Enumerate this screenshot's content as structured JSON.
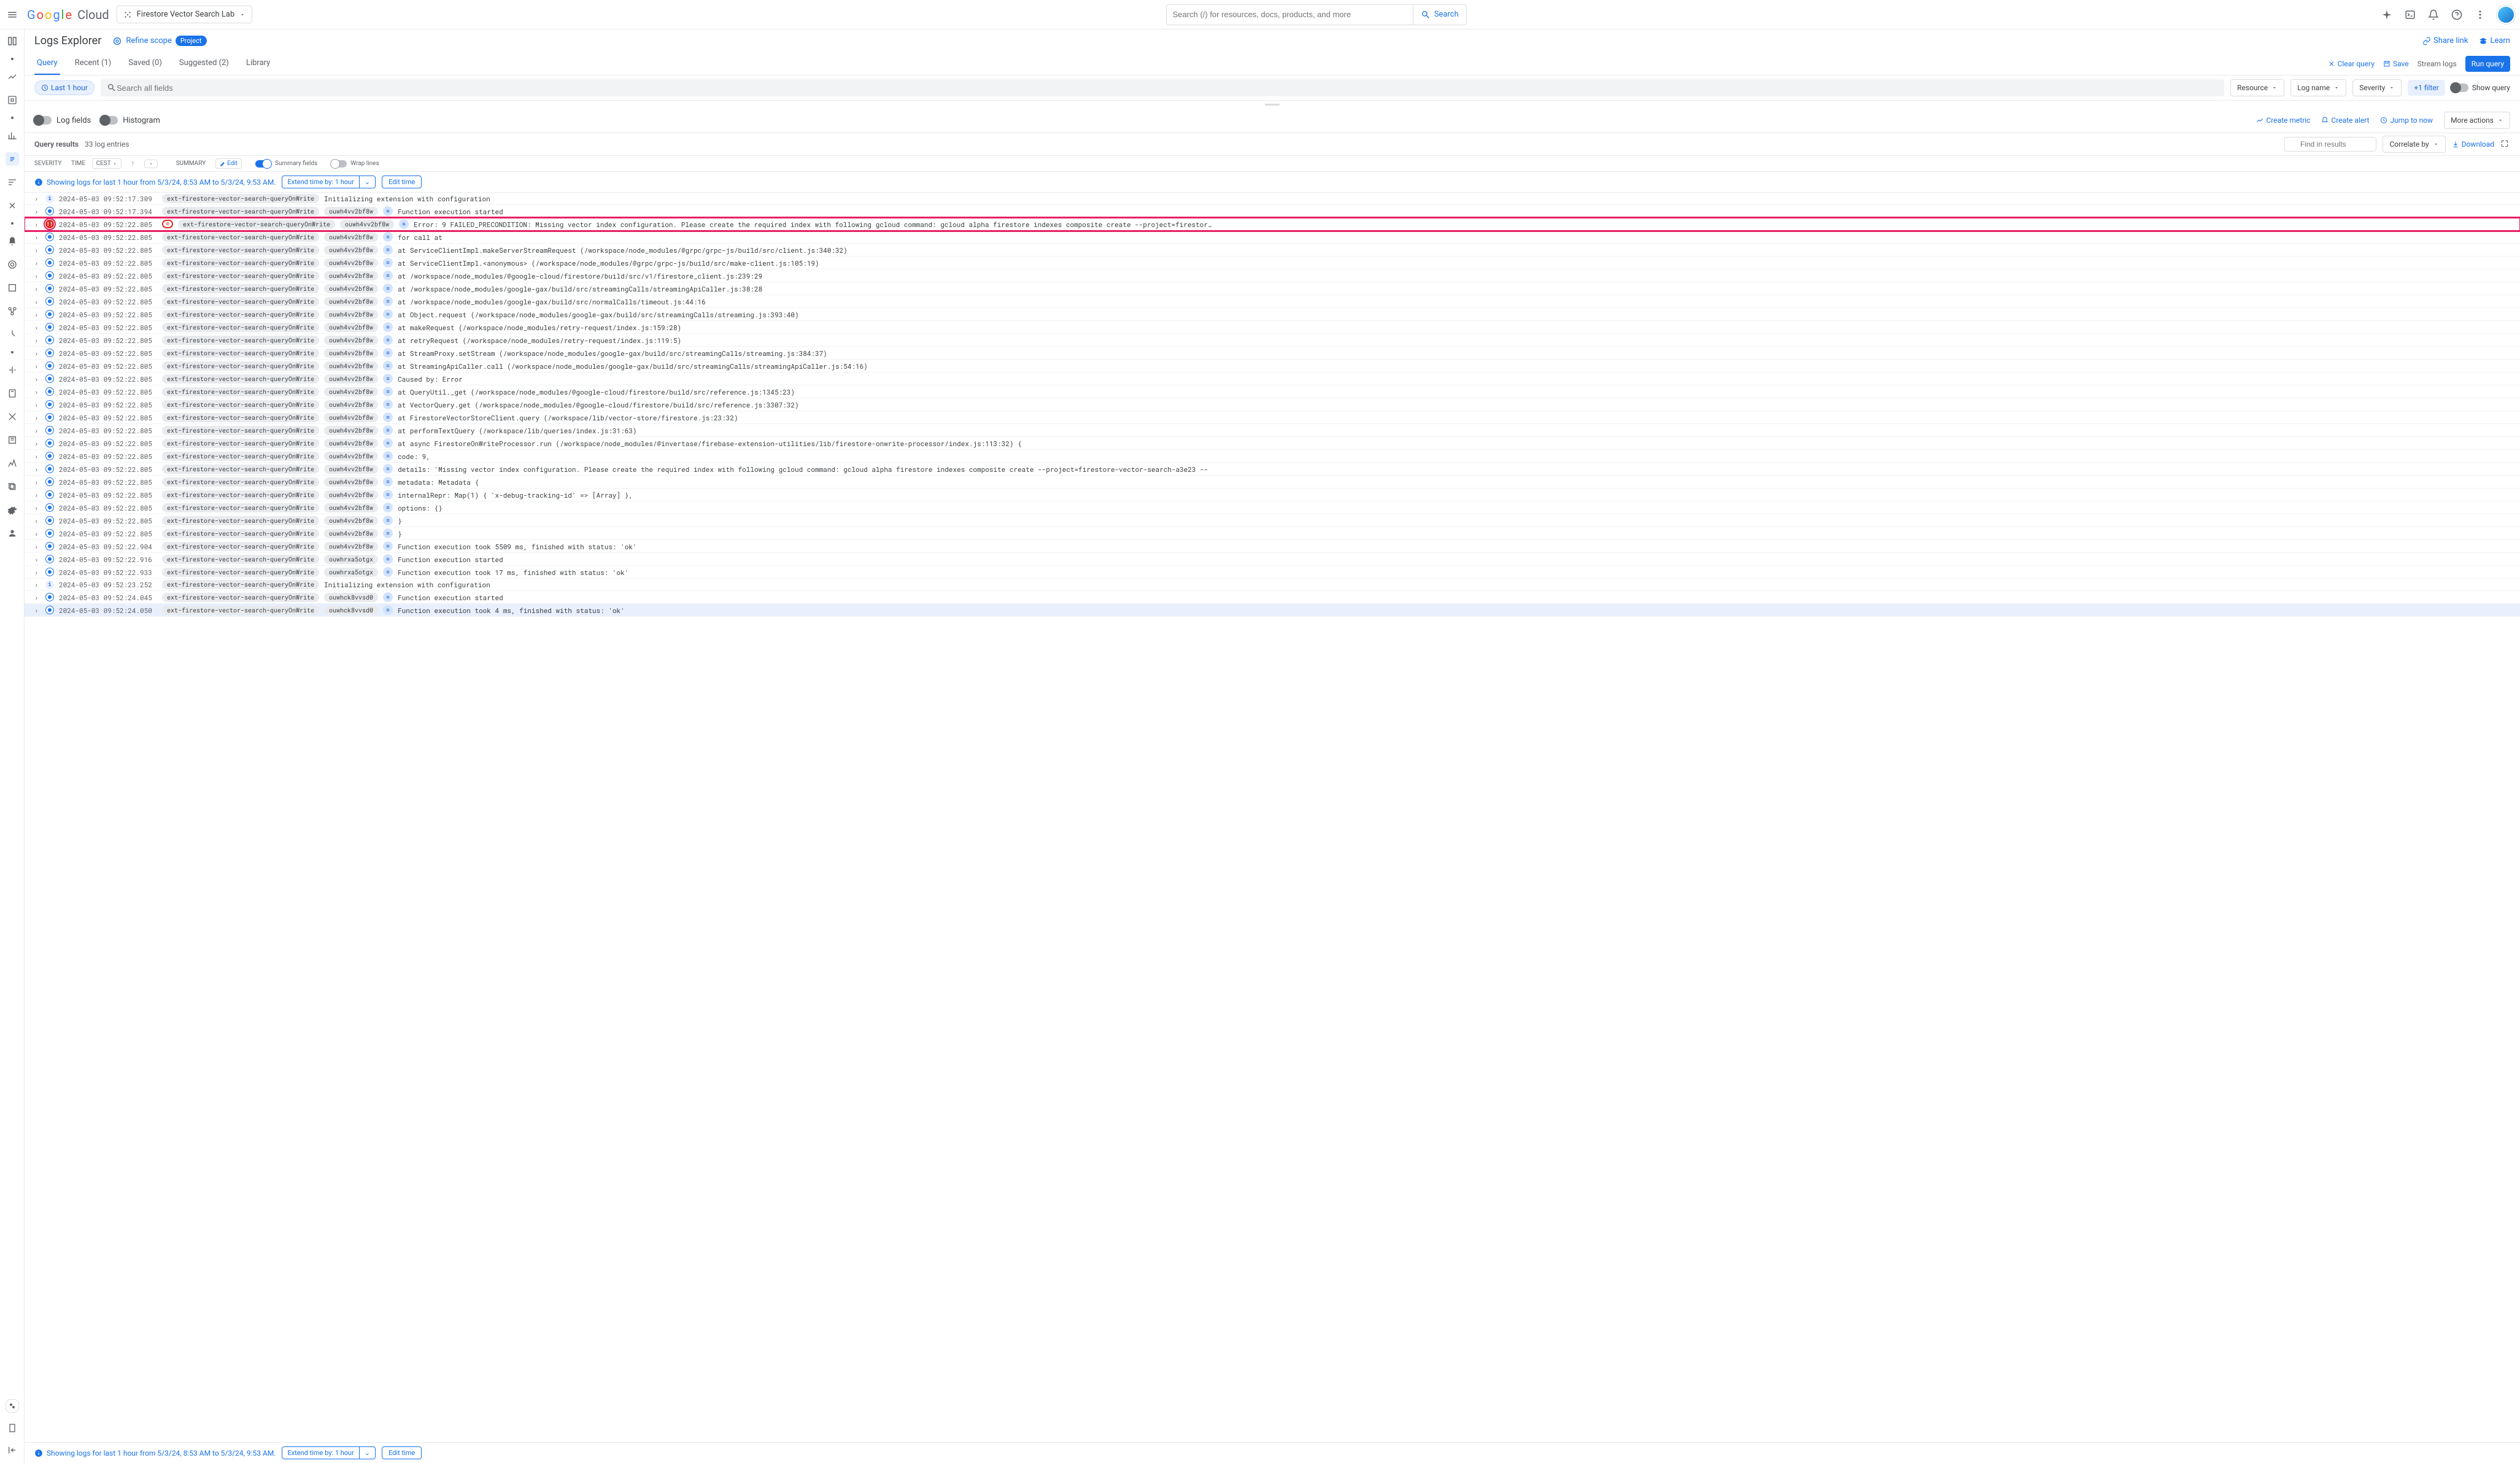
{
  "header": {
    "project": "Firestore Vector Search Lab",
    "search_placeholder": "Search (/) for resources, docs, products, and more",
    "search_btn": "Search"
  },
  "title": "Logs Explorer",
  "refine": "Refine scope",
  "project_badge": "Project",
  "share": "Share link",
  "learn": "Learn",
  "tabs": {
    "query": "Query",
    "recent": "Recent (1)",
    "saved": "Saved (0)",
    "suggested": "Suggested (2)",
    "library": "Library"
  },
  "actions": {
    "clear": "Clear query",
    "save": "Save",
    "stream": "Stream logs",
    "run": "Run query"
  },
  "filter": {
    "time_chip": "Last 1 hour",
    "search_placeholder": "Search all fields",
    "resource": "Resource",
    "logname": "Log name",
    "severity": "Severity",
    "plus1": "+1 filter",
    "showq": "Show query"
  },
  "panels": {
    "logfields": "Log fields",
    "histogram": "Histogram",
    "metric": "Create metric",
    "alert": "Create alert",
    "jump": "Jump to now",
    "more": "More actions"
  },
  "results": {
    "label": "Query results",
    "count": "33 log entries",
    "find_placeholder": "Find in results",
    "correlate": "Correlate by",
    "download": "Download"
  },
  "headers": {
    "severity": "SEVERITY",
    "time": "TIME",
    "tz": "CEST",
    "summary": "SUMMARY",
    "edit": "Edit",
    "sumfields": "Summary fields",
    "wrap": "Wrap lines"
  },
  "banner": {
    "text": "Showing logs for last 1 hour from 5/3/24, 8:53 AM to 5/3/24, 9:53 AM.",
    "extend": "Extend time by: 1 hour",
    "edit": "Edit time"
  },
  "fn": "ext-firestore-vector-search-queryOnWrite",
  "ex1": "ouwh4vv2bf8w",
  "ex2": "ouwhrxa5otgx",
  "ex3": "ouwhck8vvsd0",
  "logs": [
    {
      "sev": "info",
      "ts": "2024-05-03 09:52:17.309",
      "fn": true,
      "ex": "",
      "msg": "Initializing extension with configuration"
    },
    {
      "sev": "debug",
      "ts": "2024-05-03 09:52:17.394",
      "fn": true,
      "ex": "ouwh4vv2bf8w",
      "ic": true,
      "msg": "Function execution started"
    },
    {
      "sev": "error",
      "ts": "2024-05-03 09:52:22.805",
      "fn": true,
      "ex": "ouwh4vv2bf8w",
      "ic": true,
      "red": true,
      "hl": true,
      "msg": "Error: 9 FAILED_PRECONDITION: Missing vector index configuration. Please create the required index with following gcloud command: gcloud alpha firestore indexes composite create --project=firestor…"
    },
    {
      "sev": "debug",
      "ts": "2024-05-03 09:52:22.805",
      "fn": true,
      "ex": "ouwh4vv2bf8w",
      "ic": true,
      "msg": "for call at"
    },
    {
      "sev": "debug",
      "ts": "2024-05-03 09:52:22.805",
      "fn": true,
      "ex": "ouwh4vv2bf8w",
      "ic": true,
      "msg": "    at ServiceClientImpl.makeServerStreamRequest (/workspace/node_modules/@grpc/grpc-js/build/src/client.js:340:32)"
    },
    {
      "sev": "debug",
      "ts": "2024-05-03 09:52:22.805",
      "fn": true,
      "ex": "ouwh4vv2bf8w",
      "ic": true,
      "msg": "    at ServiceClientImpl.<anonymous> (/workspace/node_modules/@grpc/grpc-js/build/src/make-client.js:105:19)"
    },
    {
      "sev": "debug",
      "ts": "2024-05-03 09:52:22.805",
      "fn": true,
      "ex": "ouwh4vv2bf8w",
      "ic": true,
      "msg": "    at /workspace/node_modules/@google-cloud/firestore/build/src/v1/firestore_client.js:239:29"
    },
    {
      "sev": "debug",
      "ts": "2024-05-03 09:52:22.805",
      "fn": true,
      "ex": "ouwh4vv2bf8w",
      "ic": true,
      "msg": "    at /workspace/node_modules/google-gax/build/src/streamingCalls/streamingApiCaller.js:38:28"
    },
    {
      "sev": "debug",
      "ts": "2024-05-03 09:52:22.805",
      "fn": true,
      "ex": "ouwh4vv2bf8w",
      "ic": true,
      "msg": "    at /workspace/node_modules/google-gax/build/src/normalCalls/timeout.js:44:16"
    },
    {
      "sev": "debug",
      "ts": "2024-05-03 09:52:22.805",
      "fn": true,
      "ex": "ouwh4vv2bf8w",
      "ic": true,
      "msg": "    at Object.request (/workspace/node_modules/google-gax/build/src/streamingCalls/streaming.js:393:40)"
    },
    {
      "sev": "debug",
      "ts": "2024-05-03 09:52:22.805",
      "fn": true,
      "ex": "ouwh4vv2bf8w",
      "ic": true,
      "msg": "    at makeRequest (/workspace/node_modules/retry-request/index.js:159:28)"
    },
    {
      "sev": "debug",
      "ts": "2024-05-03 09:52:22.805",
      "fn": true,
      "ex": "ouwh4vv2bf8w",
      "ic": true,
      "msg": "    at retryRequest (/workspace/node_modules/retry-request/index.js:119:5)"
    },
    {
      "sev": "debug",
      "ts": "2024-05-03 09:52:22.805",
      "fn": true,
      "ex": "ouwh4vv2bf8w",
      "ic": true,
      "msg": "    at StreamProxy.setStream (/workspace/node_modules/google-gax/build/src/streamingCalls/streaming.js:384:37)"
    },
    {
      "sev": "debug",
      "ts": "2024-05-03 09:52:22.805",
      "fn": true,
      "ex": "ouwh4vv2bf8w",
      "ic": true,
      "msg": "    at StreamingApiCaller.call (/workspace/node_modules/google-gax/build/src/streamingCalls/streamingApiCaller.js:54:16)"
    },
    {
      "sev": "debug",
      "ts": "2024-05-03 09:52:22.805",
      "fn": true,
      "ex": "ouwh4vv2bf8w",
      "ic": true,
      "msg": "Caused by: Error"
    },
    {
      "sev": "debug",
      "ts": "2024-05-03 09:52:22.805",
      "fn": true,
      "ex": "ouwh4vv2bf8w",
      "ic": true,
      "msg": "    at QueryUtil._get (/workspace/node_modules/@google-cloud/firestore/build/src/reference.js:1345:23)"
    },
    {
      "sev": "debug",
      "ts": "2024-05-03 09:52:22.805",
      "fn": true,
      "ex": "ouwh4vv2bf8w",
      "ic": true,
      "msg": "    at VectorQuery.get (/workspace/node_modules/@google-cloud/firestore/build/src/reference.js:3307:32)"
    },
    {
      "sev": "debug",
      "ts": "2024-05-03 09:52:22.805",
      "fn": true,
      "ex": "ouwh4vv2bf8w",
      "ic": true,
      "msg": "    at FirestoreVectorStoreClient.query (/workspace/lib/vector-store/firestore.js:23:32)"
    },
    {
      "sev": "debug",
      "ts": "2024-05-03 09:52:22.805",
      "fn": true,
      "ex": "ouwh4vv2bf8w",
      "ic": true,
      "msg": "    at performTextQuery (/workspace/lib/queries/index.js:31:63)"
    },
    {
      "sev": "debug",
      "ts": "2024-05-03 09:52:22.805",
      "fn": true,
      "ex": "ouwh4vv2bf8w",
      "ic": true,
      "msg": "    at async FirestoreOnWriteProcessor.run (/workspace/node_modules/@invertase/firebase-extension-utilities/lib/firestore-onwrite-processor/index.js:113:32) {"
    },
    {
      "sev": "debug",
      "ts": "2024-05-03 09:52:22.805",
      "fn": true,
      "ex": "ouwh4vv2bf8w",
      "ic": true,
      "msg": "  code: 9,"
    },
    {
      "sev": "debug",
      "ts": "2024-05-03 09:52:22.805",
      "fn": true,
      "ex": "ouwh4vv2bf8w",
      "ic": true,
      "msg": "  details: 'Missing vector index configuration. Please create the required index with following gcloud command: gcloud alpha firestore indexes composite create --project=firestore-vector-search-a3e23 --"
    },
    {
      "sev": "debug",
      "ts": "2024-05-03 09:52:22.805",
      "fn": true,
      "ex": "ouwh4vv2bf8w",
      "ic": true,
      "msg": "  metadata: Metadata {"
    },
    {
      "sev": "debug",
      "ts": "2024-05-03 09:52:22.805",
      "fn": true,
      "ex": "ouwh4vv2bf8w",
      "ic": true,
      "msg": "    internalRepr: Map(1) { 'x-debug-tracking-id' => [Array] },"
    },
    {
      "sev": "debug",
      "ts": "2024-05-03 09:52:22.805",
      "fn": true,
      "ex": "ouwh4vv2bf8w",
      "ic": true,
      "msg": "    options: {}"
    },
    {
      "sev": "debug",
      "ts": "2024-05-03 09:52:22.805",
      "fn": true,
      "ex": "ouwh4vv2bf8w",
      "ic": true,
      "msg": "  }"
    },
    {
      "sev": "debug",
      "ts": "2024-05-03 09:52:22.805",
      "fn": true,
      "ex": "ouwh4vv2bf8w",
      "ic": true,
      "msg": "}"
    },
    {
      "sev": "debug",
      "ts": "2024-05-03 09:52:22.904",
      "fn": true,
      "ex": "ouwh4vv2bf8w",
      "ic": true,
      "msg": "Function execution took 5509 ms, finished with status: 'ok'"
    },
    {
      "sev": "debug",
      "ts": "2024-05-03 09:52:22.916",
      "fn": true,
      "ex": "ouwhrxa5otgx",
      "ic": true,
      "msg": "Function execution started"
    },
    {
      "sev": "debug",
      "ts": "2024-05-03 09:52:22.933",
      "fn": true,
      "ex": "ouwhrxa5otgx",
      "ic": true,
      "msg": "Function execution took 17 ms, finished with status: 'ok'"
    },
    {
      "sev": "info",
      "ts": "2024-05-03 09:52:23.252",
      "fn": true,
      "ex": "",
      "msg": "Initializing extension with configuration"
    },
    {
      "sev": "debug",
      "ts": "2024-05-03 09:52:24.045",
      "fn": true,
      "ex": "ouwhck8vvsd0",
      "ic": true,
      "msg": "Function execution started"
    },
    {
      "sev": "debug",
      "ts": "2024-05-03 09:52:24.050",
      "fn": true,
      "ex": "ouwhck8vvsd0",
      "ic": true,
      "msg": "Function execution took 4 ms, finished with status: 'ok'",
      "sel": true
    }
  ]
}
